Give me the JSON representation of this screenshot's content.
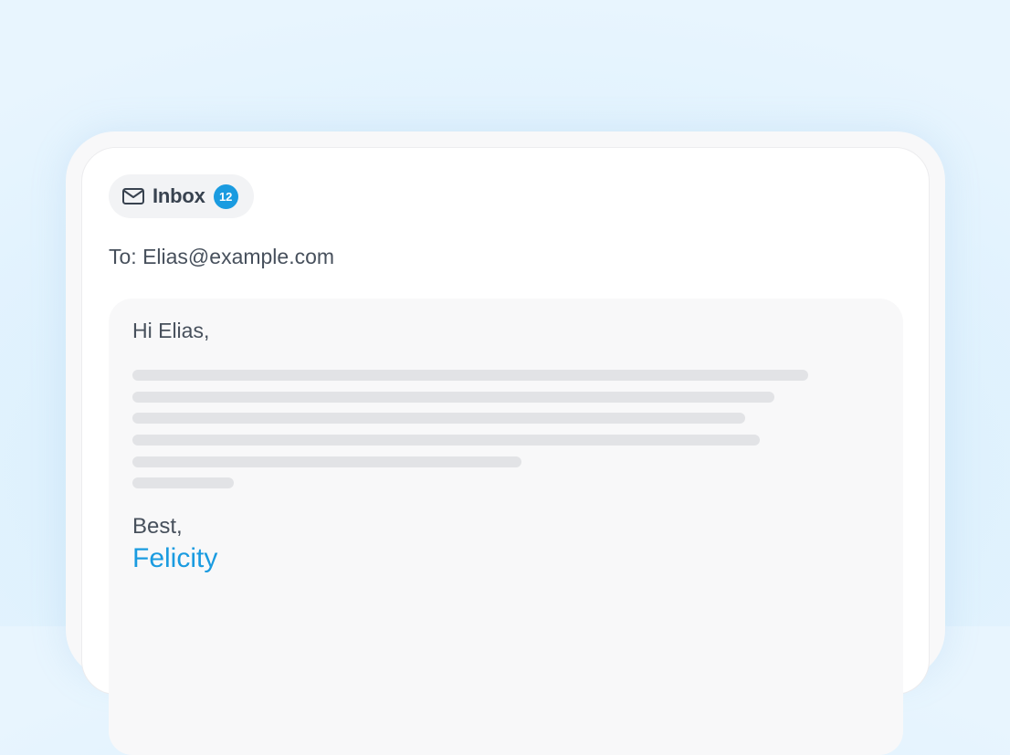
{
  "inbox": {
    "icon": "mail-icon",
    "label": "Inbox",
    "unread_count": "12",
    "badge_color": "#1a9be0"
  },
  "email": {
    "to_line": "To: Elias@example.com",
    "greeting": "Hi Elias,",
    "signoff": "Best,",
    "signature": "Felicity",
    "signature_color": "#1a9be0"
  }
}
